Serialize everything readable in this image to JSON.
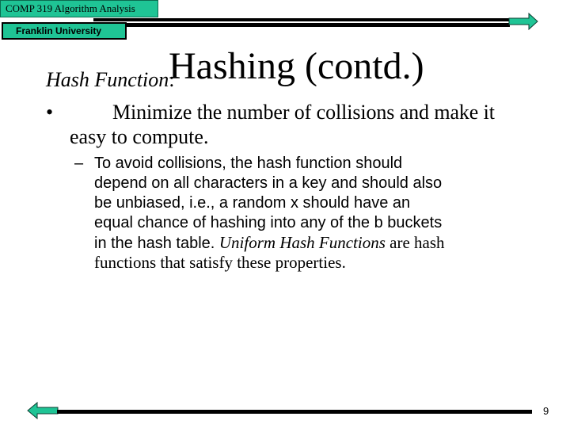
{
  "header": {
    "course_label": "COMP 319 Algorithm Analysis",
    "institution_label": "Franklin University",
    "accent_color": "#1fc495"
  },
  "navigation": {
    "next_icon": "right-arrow-icon",
    "prev_icon": "left-arrow-icon"
  },
  "slide": {
    "title": "Hashing (contd.)",
    "subheading_italic": "Hash Function",
    "subheading_suffix": ":",
    "bullet": {
      "marker": "•",
      "line1": "Minimize the number of collisions and make it",
      "line2": "easy to compute."
    },
    "sub_bullet": {
      "marker": "–",
      "lines": [
        "To avoid collisions, the hash function should",
        "depend on all characters in a key and should also",
        "be unbiased, i.e., a random x should have an",
        "equal chance of hashing into any of the b buckets"
      ],
      "line5_prefix": "in the hash table. ",
      "line5_italic": "Uniform Hash Functions",
      "line5_suffix": " are hash",
      "line6": "functions that satisfy these properties."
    }
  },
  "footer": {
    "page_number": "9"
  }
}
